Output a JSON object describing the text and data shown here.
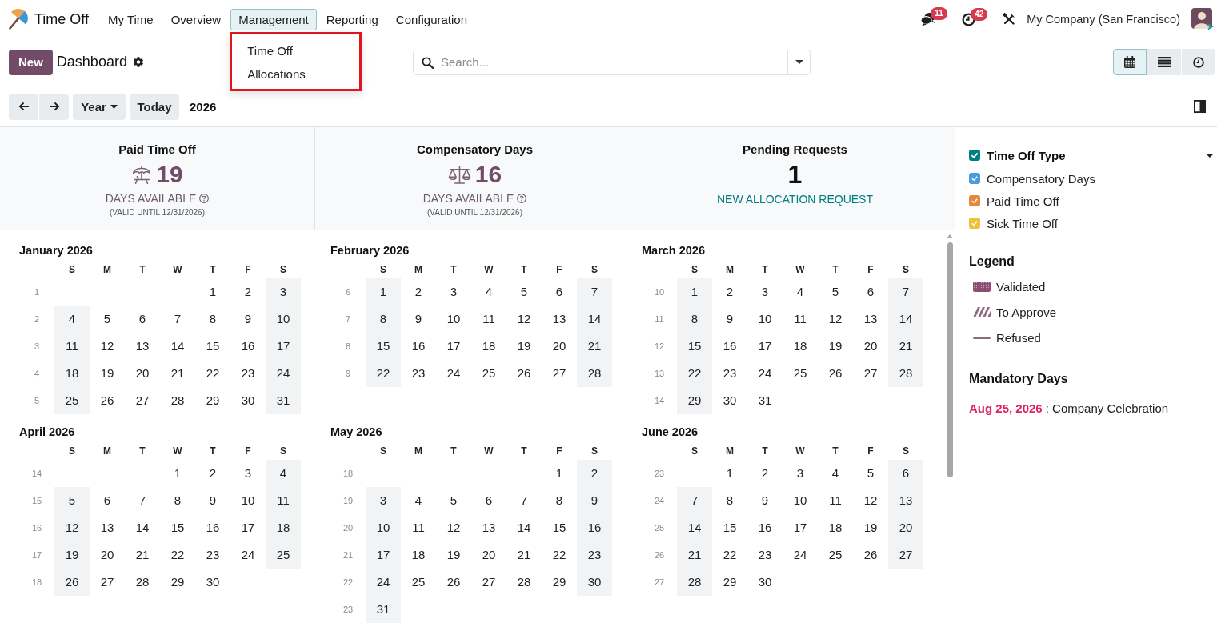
{
  "navbar": {
    "app_name": "Time Off",
    "menu": [
      {
        "label": "My Time",
        "selected": false
      },
      {
        "label": "Overview",
        "selected": false
      },
      {
        "label": "Management",
        "selected": true
      },
      {
        "label": "Reporting",
        "selected": false
      },
      {
        "label": "Configuration",
        "selected": false
      }
    ],
    "dropdown": [
      "Time Off",
      "Allocations"
    ],
    "messages_badge": "11",
    "activities_badge": "42",
    "company": "My Company (San Francisco)"
  },
  "control_panel": {
    "new_button": "New",
    "breadcrumb": "Dashboard",
    "search": {
      "placeholder": "Search..."
    },
    "views": [
      {
        "kind": "calendar",
        "selected": true
      },
      {
        "kind": "list",
        "selected": false
      },
      {
        "kind": "activity",
        "selected": false
      }
    ]
  },
  "toolbar": {
    "scale": "Year",
    "today": "Today",
    "period": "2026"
  },
  "summary_cards": [
    {
      "kind": "vacation",
      "title": "Paid Time Off",
      "value": "19",
      "caption": "DAYS AVAILABLE",
      "validity": "(VALID UNTIL 12/31/2026)"
    },
    {
      "kind": "compensatory",
      "title": "Compensatory Days",
      "value": "16",
      "caption": "DAYS AVAILABLE",
      "validity": "(VALID UNTIL 12/31/2026)"
    },
    {
      "kind": "pending",
      "title": "Pending Requests",
      "value": "1",
      "link": "NEW ALLOCATION REQUEST"
    }
  ],
  "calendar": {
    "months": [
      {
        "title": "January 2026",
        "weekdays": [
          "S",
          "M",
          "T",
          "W",
          "T",
          "F",
          "S"
        ],
        "weeks": [
          {
            "number": "1",
            "days": [
              "1",
              "2",
              "3"
            ]
          },
          {
            "number": "2",
            "days": [
              "4",
              "5",
              "6",
              "7",
              "8",
              "9",
              "10"
            ]
          },
          {
            "number": "3",
            "days": [
              "11",
              "12",
              "13",
              "14",
              "15",
              "16",
              "17"
            ]
          },
          {
            "number": "4",
            "days": [
              "18",
              "19",
              "20",
              "21",
              "22",
              "23",
              "24"
            ]
          },
          {
            "number": "5",
            "days": [
              "25",
              "26",
              "27",
              "28",
              "29",
              "30",
              "31"
            ]
          }
        ]
      },
      {
        "title": "February 2026",
        "weekdays": [
          "S",
          "M",
          "T",
          "W",
          "T",
          "F",
          "S"
        ],
        "weeks": [
          {
            "number": "6",
            "days": [
              "1",
              "2",
              "3",
              "4",
              "5",
              "6",
              "7"
            ]
          },
          {
            "number": "7",
            "days": [
              "8",
              "9",
              "10",
              "11",
              "12",
              "13",
              "14"
            ]
          },
          {
            "number": "8",
            "days": [
              "15",
              "16",
              "17",
              "18",
              "19",
              "20",
              "21"
            ]
          },
          {
            "number": "9",
            "days": [
              "22",
              "23",
              "24",
              "25",
              "26",
              "27",
              "28"
            ]
          }
        ]
      },
      {
        "title": "March 2026",
        "weekdays": [
          "S",
          "M",
          "T",
          "W",
          "T",
          "F",
          "S"
        ],
        "weeks": [
          {
            "number": "10",
            "days": [
              "1",
              "2",
              "3",
              "4",
              "5",
              "6",
              "7"
            ]
          },
          {
            "number": "11",
            "days": [
              "8",
              "9",
              "10",
              "11",
              "12",
              "13",
              "14"
            ]
          },
          {
            "number": "12",
            "days": [
              "15",
              "16",
              "17",
              "18",
              "19",
              "20",
              "21"
            ]
          },
          {
            "number": "13",
            "days": [
              "22",
              "23",
              "24",
              "25",
              "26",
              "27",
              "28"
            ]
          },
          {
            "number": "14",
            "days": [
              "29",
              "30",
              "31"
            ]
          }
        ]
      },
      {
        "title": "April 2026",
        "weekdays": [
          "S",
          "M",
          "T",
          "W",
          "T",
          "F",
          "S"
        ],
        "weeks": [
          {
            "number": "14",
            "days": [
              "1",
              "2",
              "3",
              "4"
            ]
          },
          {
            "number": "15",
            "days": [
              "5",
              "6",
              "7",
              "8",
              "9",
              "10",
              "11"
            ]
          },
          {
            "number": "16",
            "days": [
              "12",
              "13",
              "14",
              "15",
              "16",
              "17",
              "18"
            ]
          },
          {
            "number": "17",
            "days": [
              "19",
              "20",
              "21",
              "22",
              "23",
              "24",
              "25"
            ]
          },
          {
            "number": "18",
            "days": [
              "26",
              "27",
              "28",
              "29",
              "30"
            ]
          }
        ]
      },
      {
        "title": "May 2026",
        "weekdays": [
          "S",
          "M",
          "T",
          "W",
          "T",
          "F",
          "S"
        ],
        "weeks": [
          {
            "number": "18",
            "days": [
              "1",
              "2"
            ]
          },
          {
            "number": "19",
            "days": [
              "3",
              "4",
              "5",
              "6",
              "7",
              "8",
              "9"
            ]
          },
          {
            "number": "20",
            "days": [
              "10",
              "11",
              "12",
              "13",
              "14",
              "15",
              "16"
            ]
          },
          {
            "number": "21",
            "days": [
              "17",
              "18",
              "19",
              "20",
              "21",
              "22",
              "23"
            ]
          },
          {
            "number": "22",
            "days": [
              "24",
              "25",
              "26",
              "27",
              "28",
              "29",
              "30"
            ]
          },
          {
            "number": "23",
            "days": [
              "31"
            ]
          }
        ]
      },
      {
        "title": "June 2026",
        "weekdays": [
          "S",
          "M",
          "T",
          "W",
          "T",
          "F",
          "S"
        ],
        "weeks": [
          {
            "number": "23",
            "days": [
              "1",
              "2",
              "3",
              "4",
              "5",
              "6"
            ]
          },
          {
            "number": "24",
            "days": [
              "7",
              "8",
              "9",
              "10",
              "11",
              "12",
              "13"
            ]
          },
          {
            "number": "25",
            "days": [
              "14",
              "15",
              "16",
              "17",
              "18",
              "19",
              "20"
            ]
          },
          {
            "number": "26",
            "days": [
              "21",
              "22",
              "23",
              "24",
              "25",
              "26",
              "27"
            ]
          },
          {
            "number": "27",
            "days": [
              "28",
              "29",
              "30"
            ]
          }
        ]
      }
    ]
  },
  "sidebar": {
    "filter": {
      "title": "Time Off Type",
      "checked": true,
      "items": [
        {
          "label": "Compensatory Days",
          "checked": true,
          "color": "#4a9be0"
        },
        {
          "label": "Paid Time Off",
          "checked": true,
          "color": "#e5883a"
        },
        {
          "label": "Sick Time Off",
          "checked": true,
          "color": "#f0c13c"
        }
      ]
    },
    "legend": {
      "title": "Legend",
      "items": [
        {
          "kind": "validated",
          "label": "Validated"
        },
        {
          "kind": "pending",
          "label": "To Approve"
        },
        {
          "kind": "refused",
          "label": "Refused"
        }
      ]
    },
    "mandatory_days": {
      "title": "Mandatory Days",
      "items": [
        {
          "date": "Aug 25, 2026",
          "label": ": Company Celebration"
        }
      ]
    }
  }
}
